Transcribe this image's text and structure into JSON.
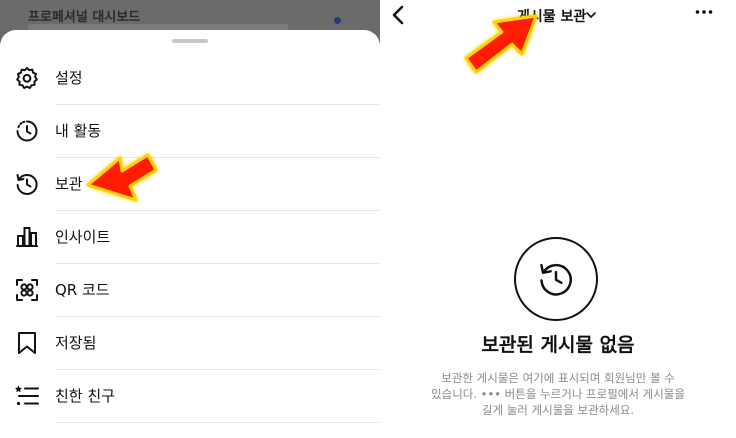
{
  "left": {
    "background_header": {
      "title": "프로페셔널 대시보드"
    },
    "menu": [
      {
        "id": "settings",
        "label": "설정",
        "icon": "gear-icon"
      },
      {
        "id": "activity",
        "label": "내 활동",
        "icon": "activity-clock-icon"
      },
      {
        "id": "archive",
        "label": "보관",
        "icon": "archive-history-icon"
      },
      {
        "id": "insights",
        "label": "인사이트",
        "icon": "bar-chart-icon"
      },
      {
        "id": "qr",
        "label": "QR 코드",
        "icon": "qr-code-icon"
      },
      {
        "id": "saved",
        "label": "저장됨",
        "icon": "bookmark-icon"
      },
      {
        "id": "close-friends",
        "label": "친한 친구",
        "icon": "star-list-icon"
      }
    ]
  },
  "right": {
    "header": {
      "title": "게시물 보관",
      "back_icon": "back-chevron-icon",
      "dropdown_icon": "chevron-down-icon",
      "more_icon": "more-horizontal-icon"
    },
    "empty_state": {
      "icon": "archive-history-icon",
      "title": "보관된 게시물 없음",
      "description": "보관한 게시물은 여기에 표시되며 회원님만 볼 수\n있습니다. ••• 버튼을 누르거나 프로필에서 게시물을\n길게 눌러 게시물을 보관하세요."
    }
  },
  "colors": {
    "annotation_arrow": "#ff1a00",
    "arrow_glow": "#ffd200",
    "text_primary": "#111111",
    "text_secondary": "#8a8a8a"
  }
}
